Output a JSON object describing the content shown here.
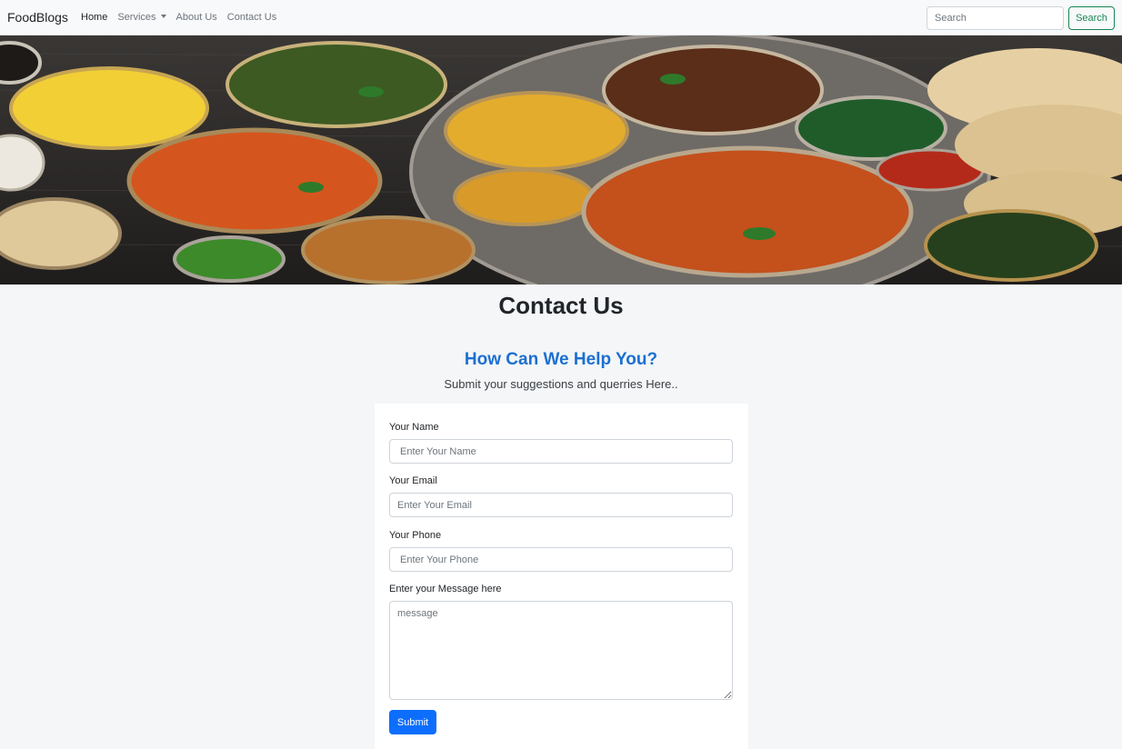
{
  "navbar": {
    "brand": "FoodBlogs",
    "links": [
      {
        "label": "Home",
        "active": true
      },
      {
        "label": "Services",
        "dropdown": true
      },
      {
        "label": "About Us"
      },
      {
        "label": "Contact Us"
      }
    ],
    "search_placeholder": "Search",
    "search_button": "Search"
  },
  "hero": {
    "image": "indian-food-spread-banner",
    "alt": "Spread of Indian dishes on a dark wooden table"
  },
  "page": {
    "title": "Contact Us",
    "help_title": "How Can We Help You?",
    "help_subtitle": "Submit your suggestions and querries Here.."
  },
  "form": {
    "name_label": "Your Name",
    "name_placeholder": "Enter Your Name",
    "email_label": "Your Email",
    "email_placeholder": "Enter Your Email",
    "phone_label": "Your Phone",
    "phone_placeholder": "Enter Your Phone",
    "message_label": "Enter your Message here",
    "message_placeholder": "message",
    "submit_label": "Submit"
  },
  "colors": {
    "accent": "#0d6efd",
    "help_title": "#1c6fd1",
    "search_button": "#198754",
    "background": "#f4f6f8"
  }
}
